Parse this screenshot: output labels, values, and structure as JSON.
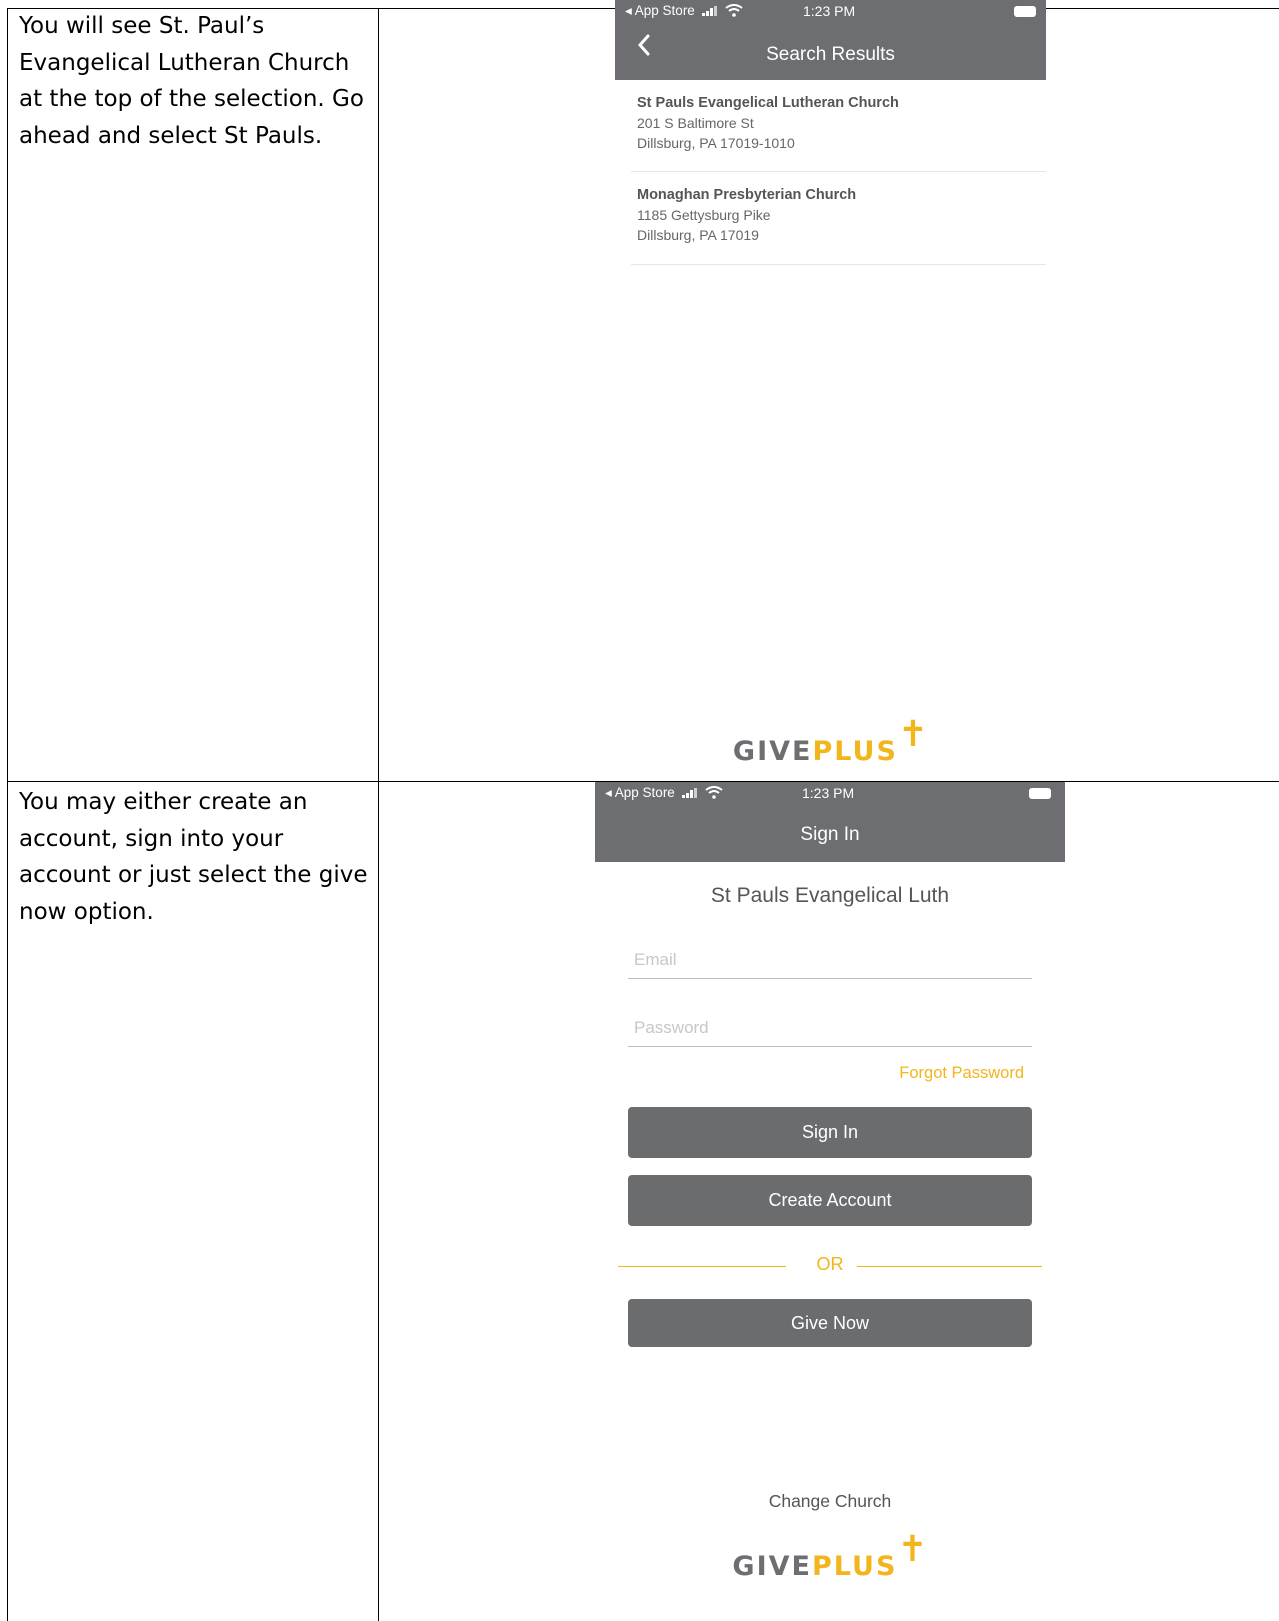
{
  "row1": {
    "instruction": "You will see St. Paul’s Evangelical Lutheran Church at the top of the selection. Go ahead and select St Pauls.",
    "phone": {
      "status": {
        "carrier": "◂ App Store",
        "time": "1:23 PM"
      },
      "title": "Search Results",
      "results": [
        {
          "name": "St Pauls Evangelical Lutheran Church",
          "street": "201 S Baltimore St",
          "city": "Dillsburg, PA 17019-1010"
        },
        {
          "name": "Monaghan Presbyterian Church",
          "street": "1185 Gettysburg Pike",
          "city": "Dillsburg, PA 17019"
        }
      ],
      "logo": {
        "give": "GIVE",
        "plus": "PLUS",
        "cross": "✝"
      }
    }
  },
  "row2": {
    "instruction": "You may either create an account, sign into your account or just select the give now option.",
    "phone": {
      "status": {
        "carrier": "◂ App Store",
        "time": "1:23 PM"
      },
      "title": "Sign In",
      "church": "St Pauls Evangelical Luth",
      "email_placeholder": "Email",
      "password_placeholder": "Password",
      "forgot": "Forgot Password",
      "sign_in": "Sign In",
      "create_account": "Create Account",
      "or": "OR",
      "give_now": "Give Now",
      "change_church": "Change Church",
      "logo": {
        "give": "GIVE",
        "plus": "PLUS",
        "cross": "✝"
      }
    }
  },
  "colors": {
    "navbar": "#6d6e71",
    "accent": "#f2b51c",
    "button": "#6a6c6e"
  },
  "icons": [
    "back-chevron-icon",
    "signal-icon",
    "wifi-icon",
    "battery-icon"
  ]
}
